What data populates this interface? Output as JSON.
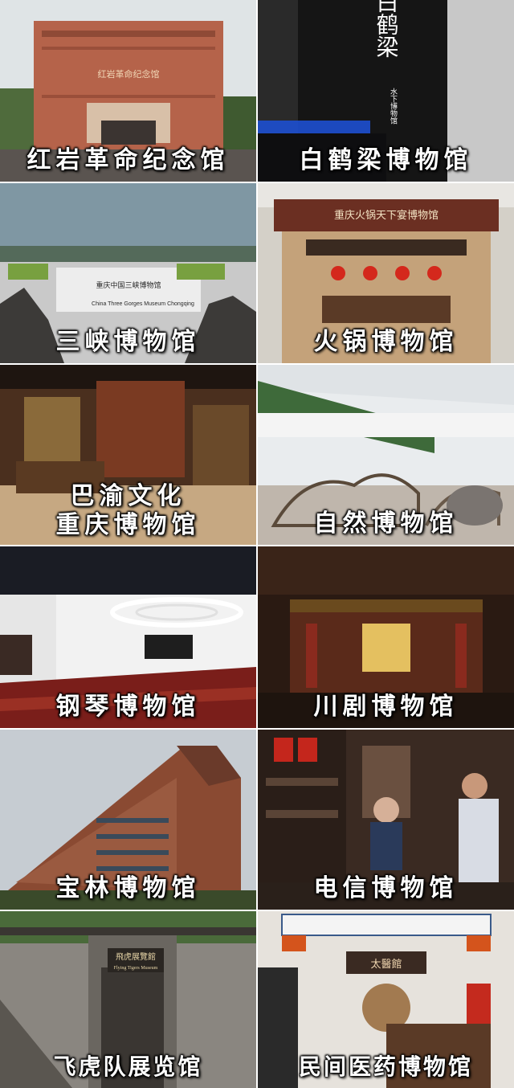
{
  "tiles": [
    {
      "caption": "红岩革命纪念馆",
      "sign": "红岩革命纪念馆"
    },
    {
      "caption": "白鹤梁博物馆",
      "sign": "白鹤梁",
      "sign_sub": "水下博物馆"
    },
    {
      "caption": "三峡博物馆",
      "sign": "重庆中国三峡博物馆",
      "sign_en": "China Three Gorges Museum Chongqing"
    },
    {
      "caption": "火锅博物馆",
      "sign": "重庆火锅天下宴博物馆"
    },
    {
      "caption_line1": "巴渝文化",
      "caption_line2": "重庆博物馆"
    },
    {
      "caption": "自然博物馆"
    },
    {
      "caption": "钢琴博物馆"
    },
    {
      "caption": "川剧博物馆"
    },
    {
      "caption": "宝林博物馆"
    },
    {
      "caption": "电信博物馆"
    },
    {
      "caption": "飞虎队展览馆",
      "sign": "飛虎展覽館",
      "sign_en": "Flying Tigers Museum"
    },
    {
      "caption": "民间医药博物馆",
      "sign": "太醫館"
    }
  ]
}
